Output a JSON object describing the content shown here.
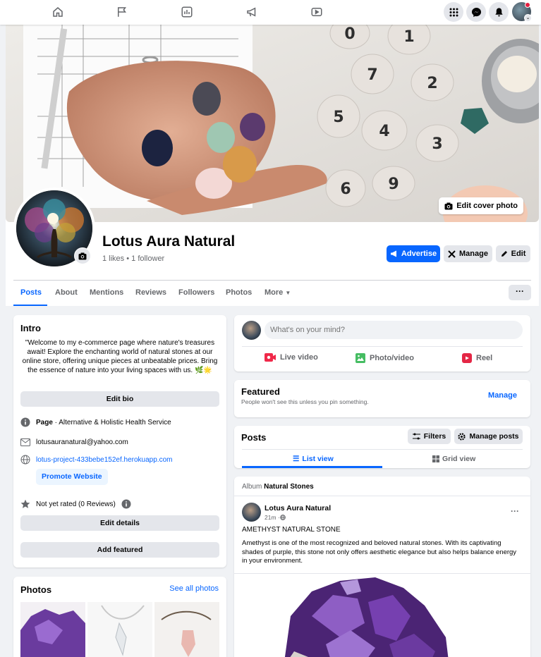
{
  "topnav": {
    "icons": [
      "home-icon",
      "pages-flag-icon",
      "insights-icon",
      "ads-megaphone-icon",
      "video-icon"
    ],
    "right_icons": [
      "menu-grid-icon",
      "messenger-icon",
      "notifications-bell-icon"
    ]
  },
  "header": {
    "edit_cover_label": "Edit cover photo",
    "page_name": "Lotus Aura Natural",
    "stats": "1 likes • 1 follower",
    "advertise_label": "Advertise",
    "manage_label": "Manage",
    "edit_label": "Edit",
    "tabs": [
      "Posts",
      "About",
      "Mentions",
      "Reviews",
      "Followers",
      "Photos",
      "More"
    ],
    "active_tab": "Posts",
    "more_dots": "···"
  },
  "intro": {
    "title": "Intro",
    "bio": "\"Welcome to my e-commerce page where nature's treasures await! Explore the enchanting world of natural stones at our online store, offering unique pieces at unbeatable prices. Bring the essence of nature into your living spaces with us. 🌿🌟",
    "edit_bio_label": "Edit bio",
    "page_label": "Page",
    "category": " · Alternative & Holistic Health Service",
    "email": "lotusauranatural@yahoo.com",
    "website": "lotus-project-433bebe152ef.herokuapp.com",
    "promote_label": "Promote Website",
    "rating": "Not yet rated (0 Reviews)",
    "edit_details_label": "Edit details",
    "add_featured_label": "Add featured"
  },
  "photos": {
    "title": "Photos",
    "see_all_label": "See all photos"
  },
  "composer": {
    "placeholder": "What's on your mind?",
    "live_label": "Live video",
    "photo_label": "Photo/video",
    "reel_label": "Reel"
  },
  "featured": {
    "title": "Featured",
    "subtitle": "People won't see this unless you pin something.",
    "manage_label": "Manage"
  },
  "posts_header": {
    "title": "Posts",
    "filters_label": "Filters",
    "manage_posts_label": "Manage posts",
    "list_view_label": "List view",
    "grid_view_label": "Grid view"
  },
  "post": {
    "album_prefix": "Album ",
    "album_name": "Natural Stones",
    "author": "Lotus Aura Natural",
    "time": "21m · ",
    "heading": "AMETHYST NATURAL STONE",
    "body": "Amethyst is one of the most recognized and beloved natural stones. With its captivating shades of purple, this stone not only offers aesthetic elegance but also helps balance energy in your environment.",
    "options": "···"
  },
  "colors": {
    "accent": "#0866ff",
    "background": "#f0f2f5",
    "button_grey": "#e4e6eb",
    "text_secondary": "#65676b"
  }
}
